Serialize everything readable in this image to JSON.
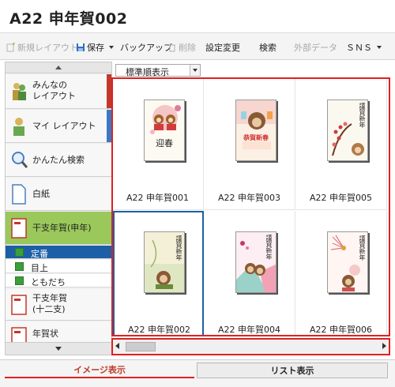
{
  "window": {
    "title": "A22 申年賀002"
  },
  "toolbar": {
    "new_layout": "新規レイアウト",
    "save": "保存",
    "backup": "バックアップ",
    "delete": "削除",
    "settings_change": "設定変更",
    "search": "検索",
    "external_data": "外部データ",
    "sns": "ＳＮＳ"
  },
  "sidebar": {
    "items": [
      {
        "label_1": "みんなの",
        "label_2": "レイアウト",
        "icon": "people-icon",
        "stripe": "#c0392b"
      },
      {
        "label_1": "マイ レイアウト",
        "icon": "person-icon",
        "stripe": "#3b78c4"
      },
      {
        "label_1": "かんたん検索",
        "icon": "magnifier-icon",
        "stripe": "#d6d6d6"
      },
      {
        "label_1": "白紙",
        "icon": "blank-page-icon",
        "stripe": "#d6d6d6"
      },
      {
        "label_1": "干支年賀(申年)",
        "icon": "eto-card-icon",
        "stripe": "#9ac85a"
      }
    ],
    "subitems": [
      "定番",
      "目上",
      "ともだち"
    ],
    "more_items": [
      {
        "label_1": "干支年賀",
        "label_2": "(十二支)",
        "icon": "eto-card-icon"
      },
      {
        "label_1": "年賀状",
        "icon": "eto-card-icon"
      }
    ]
  },
  "sort": {
    "label": "標準順表示"
  },
  "thumbnails": [
    {
      "caption": "A22 申年賀001",
      "card_text": "迎春",
      "accent": "#d23b3b",
      "bg": "#fdfaf2"
    },
    {
      "caption": "A22 申年賀003",
      "card_text": "恭賀新春",
      "accent": "#d03030",
      "bg": "#fcefe3"
    },
    {
      "caption": "A22 申年賀005",
      "card_text": "謹賀新年",
      "accent": "#c74a2a",
      "bg": "#fbf8f0"
    },
    {
      "caption": "A22 申年賀002",
      "card_text": "謹賀新年",
      "accent": "#6a8a3a",
      "bg": "#f4f0d8"
    },
    {
      "caption": "A22 申年賀004",
      "card_text": "謹賀新年",
      "accent": "#c23a6a",
      "bg": "#fdeef3"
    },
    {
      "caption": "A22 申年賀006",
      "card_text": "謹賀新年",
      "accent": "#d05050",
      "bg": "#fff6f3"
    }
  ],
  "bottom_tabs": {
    "image_view": "イメージ表示",
    "list_view": "リスト表示"
  },
  "colors": {
    "accent_red": "#e02020",
    "select_blue": "#1c5fa6",
    "eto_green": "#9ac85a"
  }
}
